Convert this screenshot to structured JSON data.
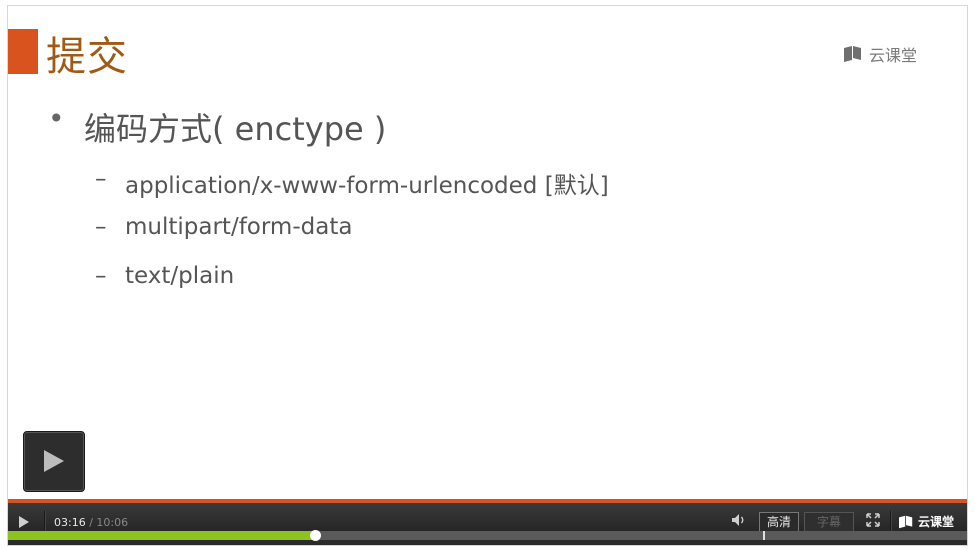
{
  "slide": {
    "title": "提交",
    "brand": "云课堂",
    "bullet": "编码方式( enctype )",
    "bullet_marker": "•",
    "sub_marker": "–",
    "sub_items": [
      "application/x-www-form-urlencoded [默认]",
      "multipart/form-data",
      "text/plain"
    ]
  },
  "player": {
    "current_time": "03:16",
    "time_separator": "/",
    "total_time": "10:06",
    "quality_label": "高清",
    "subtitle_label": "字幕",
    "brand": "云课堂",
    "progress": 0.32,
    "accent_color": "#d9531e",
    "progress_color": "#8ec31f"
  }
}
